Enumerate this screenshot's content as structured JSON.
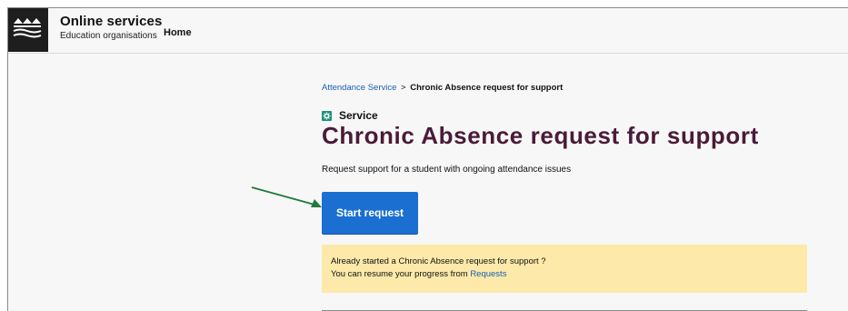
{
  "header": {
    "brand_title": "Online services",
    "brand_subtitle": "Education organisations",
    "nav_home": "Home"
  },
  "breadcrumb": {
    "link": "Attendance Service",
    "separator": ">",
    "current": "Chronic Absence request for support"
  },
  "service": {
    "tag_label": "Service",
    "title": "Chronic Absence request for support",
    "description": "Request support for a student with ongoing attendance issues"
  },
  "actions": {
    "start_label": "Start request"
  },
  "notice": {
    "line1": "Already started a Chronic Absence request for support ?",
    "line2_prefix": "You can resume your progress from",
    "line2_link": "Requests"
  },
  "colors": {
    "title": "#4a1b37",
    "primary_button": "#1b6fd1",
    "notice_bg": "#fde9a9",
    "link": "#1a5fb4",
    "service_icon": "#1f8f7a",
    "annotation_arrow": "#1e7a3c"
  },
  "icons": {
    "logo": "waves-logo-icon",
    "service": "gear-icon",
    "annotation": "arrow-right-icon"
  }
}
